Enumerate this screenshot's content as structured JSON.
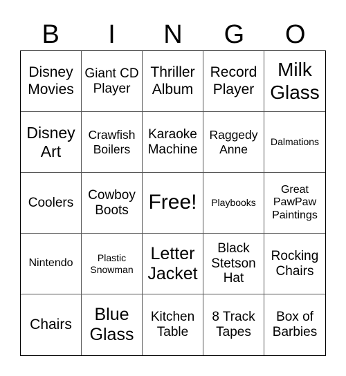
{
  "header": {
    "letters": [
      "B",
      "I",
      "N",
      "G",
      "O"
    ]
  },
  "cells": [
    [
      "Disney Movies",
      "Giant CD Player",
      "Thriller Album",
      "Record Player",
      "Milk Glass"
    ],
    [
      "Disney Art",
      "Crawfish Boilers",
      "Karaoke Machine",
      "Raggedy Anne",
      "Dalmations"
    ],
    [
      "Coolers",
      "Cowboy Boots",
      "Free!",
      "Playbooks",
      "Great PawPaw Paintings"
    ],
    [
      "Nintendo",
      "Plastic Snowman",
      "Letter Jacket",
      "Black Stetson Hat",
      "Rocking Chairs"
    ],
    [
      "Chairs",
      "Blue Glass",
      "Kitchen Table",
      "8 Track Tapes",
      "Box of Barbies"
    ]
  ]
}
